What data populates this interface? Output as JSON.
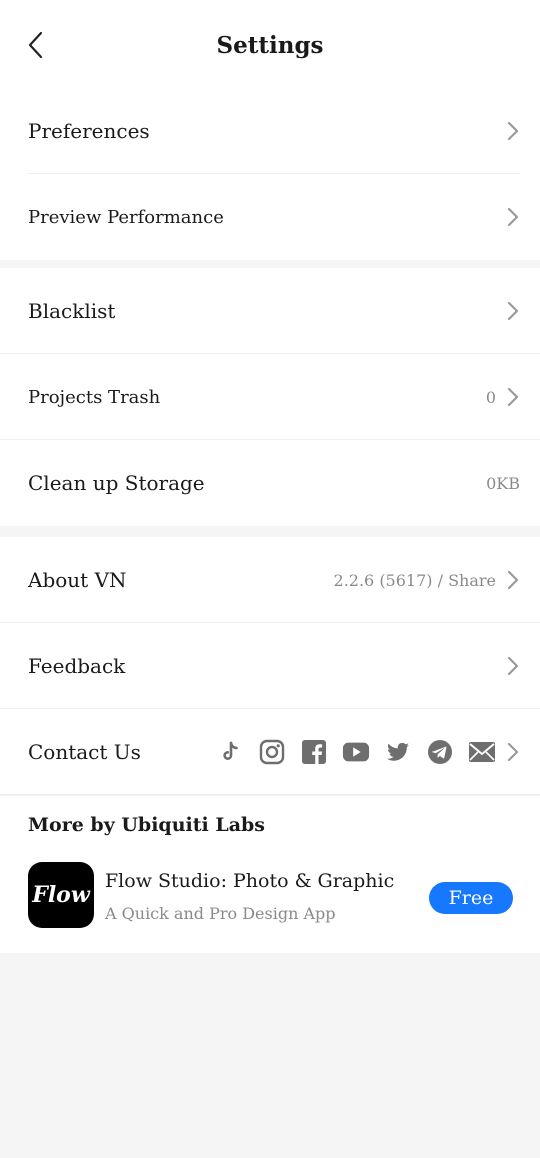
{
  "header": {
    "title": "Settings",
    "back_icon": "chevron-left-icon"
  },
  "groups": {
    "g1": [
      {
        "label": "Preferences"
      },
      {
        "label": "Preview Performance"
      }
    ],
    "g2": [
      {
        "label": "Blacklist"
      },
      {
        "label": "Projects Trash",
        "value": "0"
      },
      {
        "label": "Clean up Storage",
        "value": "0KB"
      }
    ],
    "g3": [
      {
        "label": "About VN",
        "value": "2.2.6 (5617) / Share"
      },
      {
        "label": "Feedback"
      },
      {
        "label": "Contact Us",
        "social_icons": [
          "tiktok-icon",
          "instagram-icon",
          "facebook-icon",
          "youtube-icon",
          "twitter-icon",
          "telegram-icon",
          "email-icon"
        ]
      }
    ]
  },
  "more": {
    "title": "More by Ubiquiti Labs",
    "app": {
      "icon_text": "Flow",
      "name": "Flow Studio: Photo & Graphic",
      "subtitle": "A Quick and Pro Design App",
      "button": "Free"
    }
  },
  "colors": {
    "accent": "#1677ff",
    "background": "#f5f5f5",
    "muted_text": "#8a8a8a",
    "icon_gray": "#6e6e6e"
  }
}
